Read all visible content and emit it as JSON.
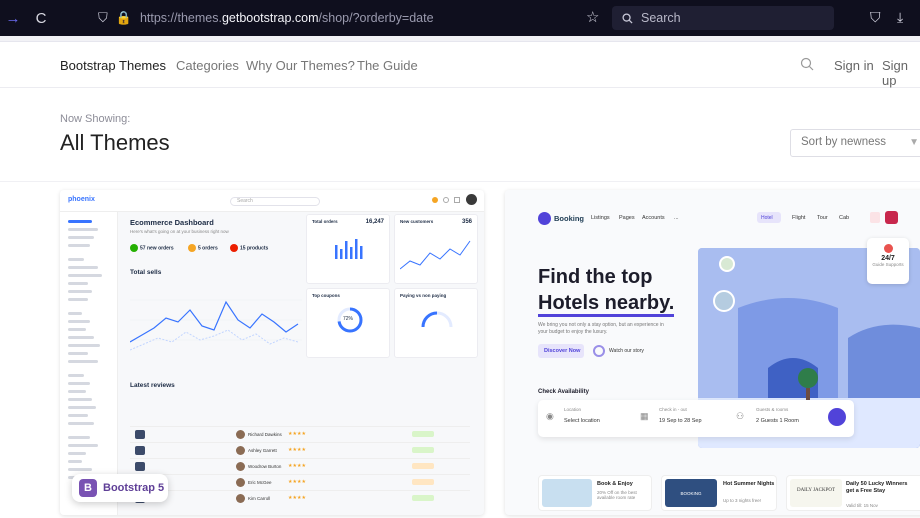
{
  "browser": {
    "url_prefix": "https://themes.",
    "url_host": "getbootstrap.com",
    "url_path": "/shop/?orderby=date",
    "search_placeholder": "Search"
  },
  "site_nav": {
    "brand": "Bootstrap Themes",
    "links": [
      "Categories",
      "Why Our Themes?",
      "The Guide"
    ],
    "sign_in": "Sign in",
    "sign_up": "Sign up"
  },
  "header": {
    "now_showing": "Now Showing:",
    "title": "All Themes",
    "sort_value": "Sort by newness"
  },
  "phoenix_card": {
    "logo": "phoenix",
    "search_placeholder": "Search",
    "dashboard_title": "Ecommerce Dashboard",
    "dashboard_subtitle": "Here's what's going on at your business right now",
    "stats": [
      {
        "value": "57 new orders",
        "color": "#25b003"
      },
      {
        "value": "5 orders",
        "color": "#f5a524"
      },
      {
        "value": "15 products",
        "color": "#ec1f00"
      }
    ],
    "total_sells": "Total sells",
    "panels": [
      {
        "label": "Total orders",
        "number": "16,247"
      },
      {
        "label": "New customers",
        "number": "356"
      },
      {
        "label": "Top coupons",
        "number": "72%"
      },
      {
        "label": "Paying vs non paying",
        "number": ""
      }
    ],
    "latest_reviews": "Latest reviews",
    "review_names": [
      "Richard Dawkins",
      "Ashley Garrett",
      "Woodrow Burton",
      "Eric McGee",
      "Kim Carroll"
    ],
    "bootstrap_badge": "Bootstrap 5",
    "accent": "#3874ff"
  },
  "booking_card": {
    "brand": "Booking",
    "nav_items": [
      "Listings",
      "Pages",
      "Accounts",
      "..."
    ],
    "tabs": [
      "Hotel",
      "Flight",
      "Tour",
      "Cab"
    ],
    "headline_line1": "Find the top",
    "headline_line2": "Hotels nearby.",
    "paragraph": "We bring you not only a stay option, but an experience in your budget to enjoy the luxury.",
    "discover_button": "Discover Now",
    "watch_video": "Watch our story",
    "check_availability": "Check Availability",
    "form": {
      "location_label": "Location",
      "location_value": "Select location",
      "check_label": "Check in - out",
      "check_value": "19 Sep to 28 Sep",
      "guests_label": "Guests & rooms",
      "guests_value": "2 Guests 1 Room"
    },
    "support_big": "24/7",
    "support_small": "Guide Supports",
    "offers": [
      {
        "title": "Book & Enjoy",
        "sub": "20% Off on the best available room rate"
      },
      {
        "title": "Hot Summer Nights",
        "sub": "Up to 3 nights free!"
      },
      {
        "title": "Daily 50 Lucky Winners get a Free Stay",
        "sub": "Valid till: 15 Nov"
      }
    ],
    "offer_images": [
      "DAILY JACKPOT",
      "BOOKING"
    ],
    "accent": "#5143d9"
  }
}
